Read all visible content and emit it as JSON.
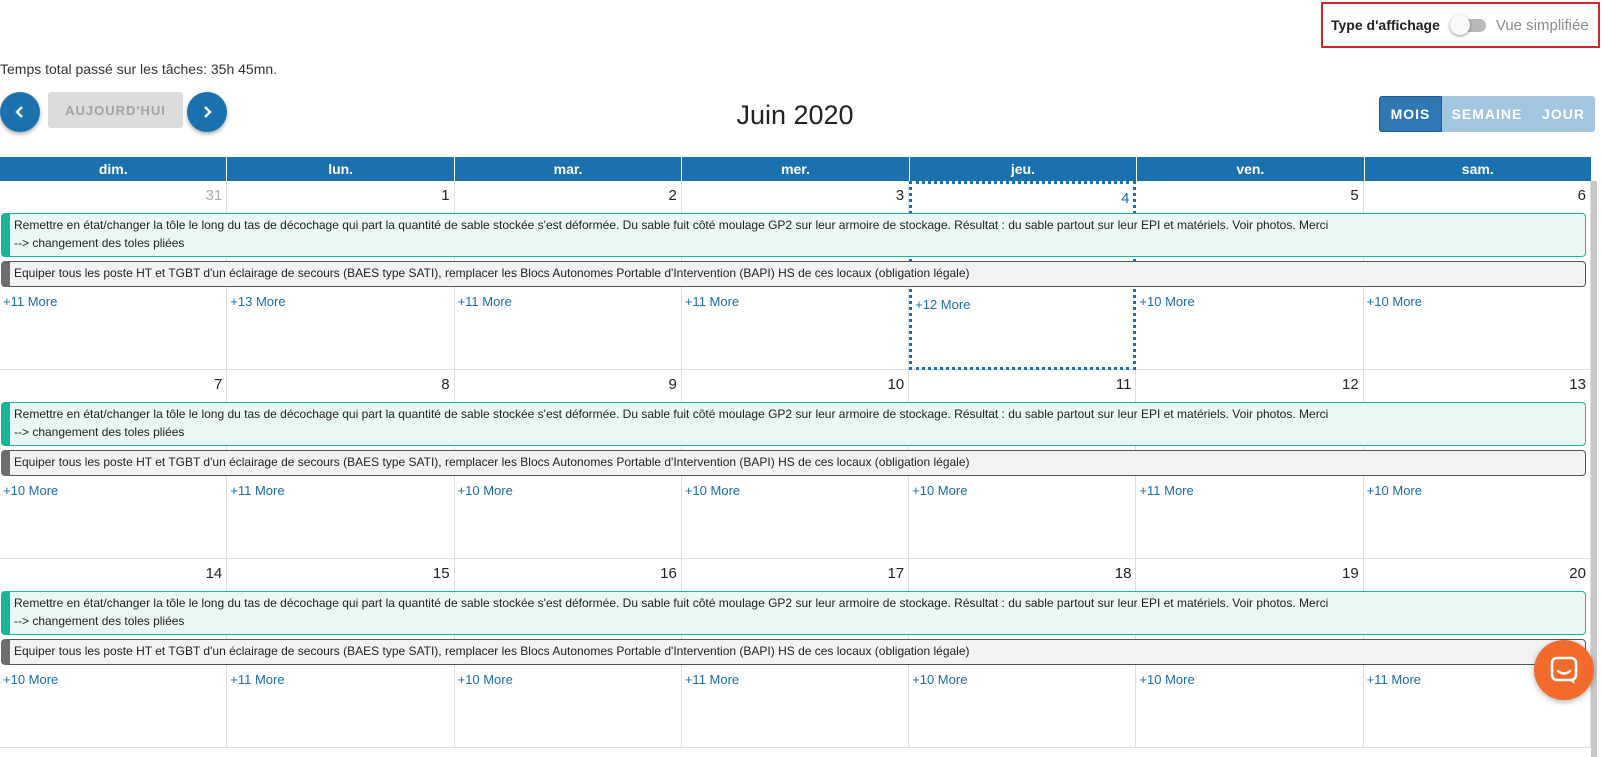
{
  "display": {
    "label": "Type d'affichage",
    "mode": "Vue simplifiée",
    "toggle_on": false
  },
  "total_time": "Temps total passé sur les tâches: 35h 45mn.",
  "nav": {
    "today": "AUJOURD'HUI",
    "prev_icon": "chevron-left-icon",
    "next_icon": "chevron-right-icon"
  },
  "month_title": "Juin 2020",
  "views": [
    "MOIS",
    "SEMAINE",
    "JOUR"
  ],
  "active_view": "MOIS",
  "weekdays": [
    "dim.",
    "lun.",
    "mar.",
    "mer.",
    "jeu.",
    "ven.",
    "sam."
  ],
  "events": {
    "green": [
      "Remettre en état/changer la tôle le long du tas de décochage qui part la quantité de sable stockée s'est déformée. Du sable fuit côté moulage GP2 sur leur armoire de stockage. Résultat : du sable partout sur leur EPI et matériels. Voir photos. Merci",
      "--> changement des toles pliées"
    ],
    "grey": "Equiper tous les poste HT et TGBT d'un éclairage de secours (BAES type SATI), remplacer les Blocs Autonomes Portable d'Intervention (BAPI) HS de ces locaux (obligation légale)"
  },
  "weeks": [
    {
      "days": [
        "31",
        "1",
        "2",
        "3",
        "4",
        "5",
        "6"
      ],
      "more": [
        "+11 More",
        "+13 More",
        "+11 More",
        "+11 More",
        "+12 More",
        "+10 More",
        "+10 More"
      ]
    },
    {
      "days": [
        "7",
        "8",
        "9",
        "10",
        "11",
        "12",
        "13"
      ],
      "more": [
        "+10 More",
        "+11 More",
        "+10 More",
        "+10 More",
        "+10 More",
        "+11 More",
        "+10 More"
      ]
    },
    {
      "days": [
        "14",
        "15",
        "16",
        "17",
        "18",
        "19",
        "20"
      ],
      "more": [
        "+10 More",
        "+11 More",
        "+10 More",
        "+11 More",
        "+10 More",
        "+10 More",
        "+11 More"
      ]
    }
  ],
  "chat_icon": "chat-icon"
}
